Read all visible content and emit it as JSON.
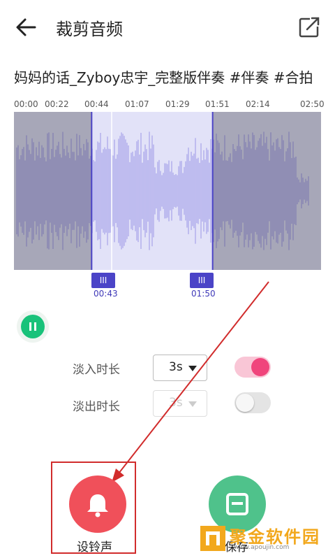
{
  "header": {
    "title": "裁剪音频",
    "back_icon": "arrow-left-icon",
    "share_icon": "share-icon"
  },
  "song_title": "妈妈的话_Zyboy忠宇_完整版伴奏 #伴奏 #合拍",
  "timeline": [
    "00:00",
    "00:22",
    "00:44",
    "01:07",
    "01:29",
    "01:51",
    "02:14",
    "02:50"
  ],
  "selection": {
    "start_label": "00:43",
    "end_label": "01:50",
    "handle_glyph": "III",
    "start_fraction": 0.253,
    "end_fraction": 0.647
  },
  "player": {
    "state_icon": "pause-icon"
  },
  "fade_in": {
    "label": "淡入时长",
    "value": "3s",
    "enabled": true
  },
  "fade_out": {
    "label": "淡出时长",
    "value": "3s",
    "enabled": false
  },
  "actions": {
    "ringtone_label": "设铃声",
    "save_label": "保存"
  },
  "watermark": {
    "text": "聚金软件园",
    "url": "www.apoujin.com"
  },
  "colors": {
    "accent": "#4b44c7",
    "ringtone": "#f0505a",
    "save": "#4fc28b",
    "toggle_on": "#f0457c",
    "annotation": "#d12c2c"
  }
}
